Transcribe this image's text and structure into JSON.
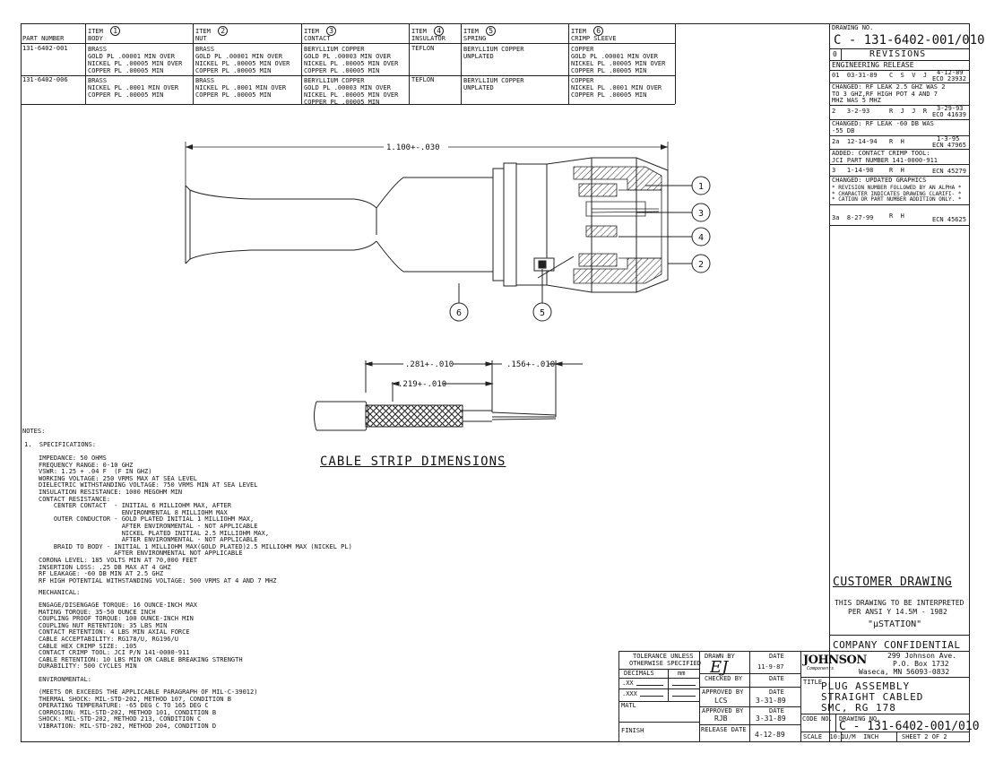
{
  "parts_table": {
    "part_number_header": "PART NUMBER",
    "columns": [
      {
        "item": "ITEM",
        "num": "1",
        "name": "BODY"
      },
      {
        "item": "ITEM",
        "num": "2",
        "name": "NUT"
      },
      {
        "item": "ITEM",
        "num": "3",
        "name": "CONTACT"
      },
      {
        "item": "ITEM",
        "num": "4",
        "name": "INSULATOR"
      },
      {
        "item": "ITEM",
        "num": "5",
        "name": "SPRING"
      },
      {
        "item": "ITEM",
        "num": "6",
        "name": "CRIMP SLEEVE"
      }
    ],
    "rows": [
      {
        "part": "131-6402-001",
        "cells": [
          [
            "BRASS",
            "GOLD PL .00001 MIN OVER",
            "NICKEL PL .00005 MIN OVER",
            "COPPER PL .00005 MIN"
          ],
          [
            "BRASS",
            "GOLD PL .00001 MIN OVER",
            "NICKEL PL .00005 MIN OVER",
            "COPPER PL .00005 MIN"
          ],
          [
            "BERYLLIUM COPPER",
            "GOLD PL .00003 MIN OVER",
            "NICKEL PL .00005 MIN OVER",
            "COPPER PL .00005 MIN"
          ],
          [
            "TEFLON"
          ],
          [
            "BERYLLIUM COPPER",
            "UNPLATED"
          ],
          [
            "COPPER",
            "GOLD PL .00001 MIN OVER",
            "NICKEL PL .00005 MIN OVER",
            "COPPER PL .00005 MIN"
          ]
        ]
      },
      {
        "part": "131-6402-006",
        "cells": [
          [
            "BRASS",
            "NICKEL PL .0001 MIN OVER",
            "COPPER PL .00005 MIN"
          ],
          [
            "BRASS",
            "NICKEL PL .0001 MIN OVER",
            "COPPER PL .00005 MIN"
          ],
          [
            "BERYLLIUM COPPER",
            "GOLD PL .00003 MIN OVER",
            "NICKEL PL .00005 MIN OVER",
            "COPPER PL .00005 MIN"
          ],
          [
            "TEFLON"
          ],
          [
            "BERYLLIUM COPPER",
            "UNPLATED"
          ],
          [
            "COPPER",
            "NICKEL PL .0001 MIN OVER",
            "COPPER PL .00005 MIN"
          ]
        ]
      }
    ]
  },
  "assembly": {
    "length_dim": "1.100+-.030",
    "balloons": [
      "1",
      "3",
      "4",
      "2",
      "6",
      "5"
    ]
  },
  "cable_strip": {
    "dim_a": ".281+-.010",
    "dim_b": ".219+-.010",
    "dim_c": ".156+-.010",
    "title": "CABLE STRIP DIMENSIONS"
  },
  "notes": {
    "heading": "NOTES:",
    "spec_heading": "1.  SPECIFICATIONS:",
    "spec_lines": [
      "IMPEDANCE: 50 OHMS",
      "FREQUENCY RANGE: 0-10 GHZ",
      "VSWR: 1.25 + .04 F  (F IN GHZ)",
      "WORKING VOLTAGE: 250 VRMS MAX AT SEA LEVEL",
      "DIELECTRIC WITHSTANDING VOLTAGE: 750 VRMS MIN AT SEA LEVEL",
      "INSULATION RESISTANCE: 1000 MEGOHM MIN",
      "CONTACT RESISTANCE:",
      "    CENTER CONTACT  - INITIAL 6 MILLIOHM MAX, AFTER",
      "                      ENVIRONMENTAL 8 MILLIOHM MAX",
      "    OUTER CONDUCTOR - GOLD PLATED INITIAL 1 MILLIOHM MAX,",
      "                      AFTER ENVIRONMENTAL - NOT APPLICABLE",
      "                      NICKEL PLATED INITIAL 2.5 MILLIOHM MAX,",
      "                      AFTER ENVIRONMENTAL - NOT APPLICABLE",
      "    BRAID TO BODY - INITIAL 1 MILLIOHM MAX(GOLD PLATED)2.5 MILLIOHM MAX (NICKEL PL)",
      "                    AFTER ENVIRONMENTAL NOT APPLICABLE",
      "CORONA LEVEL: 185 VOLTS MIN AT 70,000 FEET",
      "INSERTION LOSS: .25 DB MAX AT 4 GHZ",
      "RF LEAKAGE: -60 DB MIN AT 2.5 GHZ",
      "RF HIGH POTENTIAL WITHSTANDING VOLTAGE: 500 VRMS AT 4 AND 7 MHZ"
    ],
    "mech_heading": "MECHANICAL:",
    "mech_lines": [
      "ENGAGE/DISENGAGE TORQUE: 16 OUNCE-INCH MAX",
      "MATING TORQUE: 35-50 OUNCE INCH",
      "COUPLING PROOF TORQUE: 100 OUNCE-INCH MIN",
      "COUPLING NUT RETENTION: 35 LBS MIN",
      "CONTACT RETENTION: 4 LBS MIN AXIAL FORCE",
      "CABLE ACCEPTABILITY: RG178/U, RG196/U",
      "CABLE HEX CRIMP SIZE: .105",
      "CONTACT CRIMP TOOL: JCI P/N 141-0000-911",
      "CABLE RETENTION: 10 LBS MIN OR CABLE BREAKING STRENGTH",
      "DURABILITY: 500 CYCLES MIN"
    ],
    "env_heading": "ENVIRONMENTAL:",
    "env_lines": [
      "(MEETS OR EXCEEDS THE APPLICABLE PARAGRAPH OF MIL-C-39012)",
      "THERMAL SHOCK: MIL-STD-202, METHOD 107, CONDITION B",
      "OPERATING TEMPERATURE: -65 DEG C TO 165 DEG C",
      "CORROSION: MIL-STD-202, METHOD 101, CONDITION B",
      "SHOCK: MIL-STD-202, METHOD 213, CONDITION C",
      "VIBRATION: MIL-STD-202, METHOD 204, CONDITION D"
    ]
  },
  "revisions": {
    "drawing_no_label": "DRAWING NO.",
    "drawing_no": "C - 131-6402-001/010",
    "rev_col": "0",
    "header": "REVISIONS",
    "eng_release": "ENGINEERING RELEASE",
    "entries": [
      {
        "rev": "01",
        "date": "03-31-89",
        "init": "C  S  V  J",
        "ecn_date": "4-12-89",
        "ecn": "ECO 23932"
      },
      {
        "rev": "2",
        "date": "3-2-93",
        "init": "R  J  J  R",
        "ecn_date": "3-29-93",
        "ecn": "ECO 41639"
      },
      {
        "rev": "2a",
        "date": "12-14-94",
        "init": "R  H",
        "ecn_date": "1-3-95",
        "ecn": "ECN 47965"
      },
      {
        "rev": "3",
        "date": "1-14-98",
        "init": "R  H",
        "ecn_date": "",
        "ecn": "ECN 45279"
      },
      {
        "rev": "3a",
        "date": "8-27-99",
        "init": "R  H",
        "ecn_date": "",
        "ecn": "ECN 45625"
      }
    ],
    "changes": [
      "CHANGED: RF LEAK 2.5 GHZ WAS 2",
      "TO 3 GHZ,RF HIGH POT 4 AND 7",
      "MHZ WAS 5 MHZ",
      "CHANGED: RF LEAK -60 DB WAS",
      "-55 DB",
      "ADDED: CONTACT CRIMP TOOL:",
      "JCI PART NUMBER 141-0000-911",
      "CHANGED: UPDATED GRAPHICS",
      "* REVISION NUMBER FOLLOWED BY AN ALPHA *",
      "* CHARACTER INDICATES DRAWING CLARIFI- *",
      "* CATION OR PART NUMBER ADDITION ONLY. *"
    ]
  },
  "customer": {
    "title": "CUSTOMER DRAWING",
    "line1": "THIS DRAWING TO BE INTERPRETED",
    "line2": "PER ANSI Y 14.5M - 1982",
    "station": "\"μSTATION\"",
    "confidential": "COMPANY CONFIDENTIAL"
  },
  "title_block": {
    "tol_line1": "TOLERANCE UNLESS",
    "tol_line2": "OTHERWISE SPECIFIED",
    "decimals": "DECIMALS",
    "mm": "mm",
    "xx": ".XX",
    "xxx": ".XXX",
    "matl": "MATL",
    "finish": "FINISH",
    "drawn_by": "DRAWN BY",
    "drawn_sig": "EJ",
    "drawn_date": "11-9-87",
    "date_label": "DATE",
    "checked_by": "CHECKED BY",
    "approved_by": "APPROVED BY",
    "approved1": "LCS",
    "approved1_date": "3-31-89",
    "approved2": "RJB",
    "approved2_date": "3-31-89",
    "release_date_label": "RELEASE DATE",
    "release_date": "4-12-89",
    "company": "JOHNSON",
    "company_sub": "Components",
    "address1": "299 Johnson Ave.",
    "address2": "P.O. Box 1732",
    "address3": "Waseca, MN 56093-0832",
    "title_label": "TITLE",
    "title1": "PLUG ASSEMBLY",
    "title2": "STRAIGHT CABLED",
    "title3": "SMC, RG 178",
    "code_no": "CODE NO.",
    "drawing_no_label": "DRAWING NO.",
    "drawing_no": "C - 131-6402-001/010",
    "scale": "SCALE  10:1",
    "units": "U/M  INCH",
    "sheet": "SHEET 2 OF 2"
  }
}
